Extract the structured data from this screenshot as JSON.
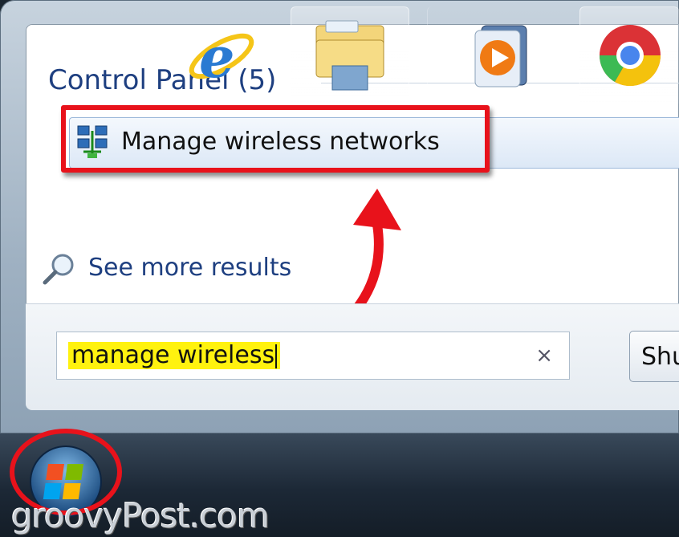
{
  "start_menu": {
    "section_title": "Control Panel (5)",
    "result": {
      "label": "Manage wireless networks",
      "icon": "network-icon"
    },
    "see_more": {
      "label": "See more results",
      "icon": "magnifier-icon"
    },
    "search": {
      "value": "manage wireless",
      "clear_icon": "×"
    },
    "shutdown": {
      "label": "Shut down"
    }
  },
  "taskbar": {
    "items": [
      {
        "name": "start-orb",
        "icon": "windows-logo-icon"
      },
      {
        "name": "internet-explorer",
        "icon": "ie-icon"
      },
      {
        "name": "windows-explorer",
        "icon": "folder-icon"
      },
      {
        "name": "media-player",
        "icon": "media-player-icon"
      },
      {
        "name": "chrome",
        "icon": "chrome-icon"
      }
    ]
  },
  "annotations": {
    "highlight_color": "#e8121b",
    "search_highlight": "#fff20f"
  },
  "watermark": "groovyPost.com"
}
